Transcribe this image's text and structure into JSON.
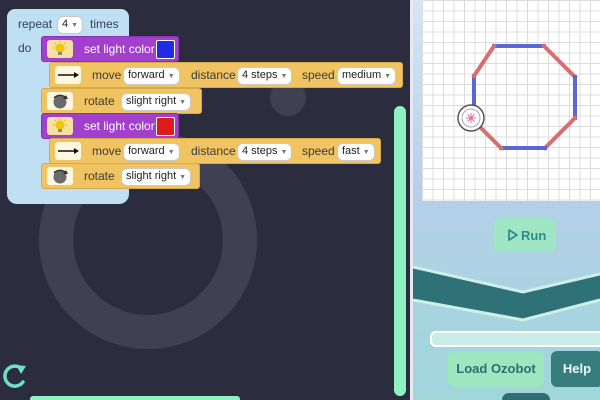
{
  "program": {
    "repeat": {
      "label": "repeat",
      "count": "4",
      "times_label": "times",
      "do_label": "do"
    },
    "blocks": [
      {
        "type": "light",
        "label": "set light color",
        "color": "#1f2de6"
      },
      {
        "type": "move",
        "label": "move",
        "direction": "forward",
        "distance_label": "distance",
        "distance": "4 steps",
        "speed_label": "speed",
        "speed": "medium"
      },
      {
        "type": "rotate",
        "label": "rotate",
        "value": "slight right"
      },
      {
        "type": "light",
        "label": "set light color",
        "color": "#e01b1b"
      },
      {
        "type": "move",
        "label": "move",
        "direction": "forward",
        "distance_label": "distance",
        "distance": "4 steps",
        "speed_label": "speed",
        "speed": "fast"
      },
      {
        "type": "rotate",
        "label": "rotate",
        "value": "slight right"
      }
    ]
  },
  "simulator": {
    "path_colors": [
      "#5a68d6",
      "#d86e6e"
    ],
    "run_label": "Run"
  },
  "footer": {
    "load_label": "Load Ozobot",
    "help_label": "Help"
  },
  "colors": {
    "workspace_bg": "#2b2d3e",
    "accent": "#8ff0c0",
    "control_block": "#bfe0f2",
    "light_block": "#a23fcc",
    "action_block": "#f1c463",
    "help_button": "#377d7e"
  },
  "icons": [
    "reset-icon",
    "light-bulb-icon",
    "arrow-right-icon",
    "rotate-icon",
    "play-icon",
    "ozobot-icon"
  ]
}
